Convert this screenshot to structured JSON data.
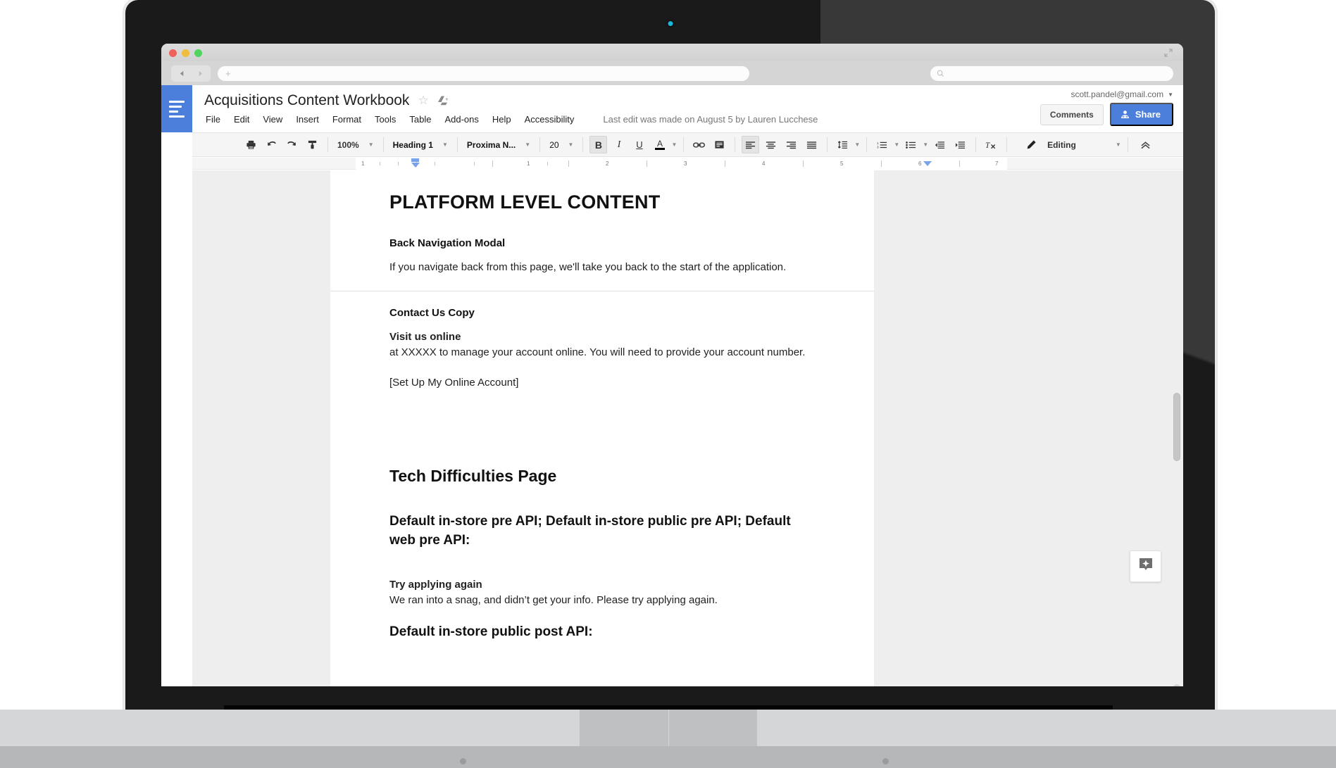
{
  "browser": {
    "traffic_lights": [
      "close",
      "minimize",
      "zoom"
    ],
    "back_label": "◀",
    "forward_label": "▶",
    "url_value": "",
    "url_placeholder": "+",
    "search_value": "",
    "search_placeholder": "",
    "expand_icon": "expand-icon"
  },
  "app": {
    "title": "Acquisitions Content Workbook",
    "star_icon": "☆",
    "drive_icon": "drive-icon",
    "menu": [
      {
        "label": "File"
      },
      {
        "label": "Edit"
      },
      {
        "label": "View"
      },
      {
        "label": "Insert"
      },
      {
        "label": "Format"
      },
      {
        "label": "Tools"
      },
      {
        "label": "Table"
      },
      {
        "label": "Add-ons"
      },
      {
        "label": "Help"
      },
      {
        "label": "Accessibility"
      }
    ],
    "last_edit": "Last edit was made on August 5 by Lauren Lucchese",
    "account_email": "scott.pandel@gmail.com",
    "comments_label": "Comments",
    "share_label": "Share",
    "accent_blue": "#4b7fdb"
  },
  "toolbar": {
    "print_icon": "print-icon",
    "undo_icon": "undo-icon",
    "redo_icon": "redo-icon",
    "paint_format_icon": "paint-format-icon",
    "zoom_value": "100%",
    "style_value": "Heading 1",
    "font_value": "Proxima N...",
    "size_value": "20",
    "bold_label": "B",
    "italic_label": "I",
    "underline_label": "U",
    "text_color_label": "A",
    "link_icon": "link-icon",
    "comment_icon": "add-comment-icon",
    "align_left_icon": "align-left-icon",
    "align_center_icon": "align-center-icon",
    "align_right_icon": "align-right-icon",
    "align_justify_icon": "align-justify-icon",
    "line_spacing_icon": "line-spacing-icon",
    "numbered_list_icon": "numbered-list-icon",
    "bulleted_list_icon": "bulleted-list-icon",
    "outdent_icon": "decrease-indent-icon",
    "indent_icon": "increase-indent-icon",
    "clear_format_icon": "clear-formatting-icon",
    "mode_label": "Editing",
    "pencil_icon": "pencil-icon",
    "collapse_icon": "collapse-toolbar-icon"
  },
  "ruler": {
    "numbers": [
      "1",
      "1",
      "2",
      "3",
      "4",
      "5",
      "6",
      "7"
    ]
  },
  "document": {
    "heading": "PLATFORM LEVEL CONTENT",
    "sections": [
      {
        "subheading": "Back Navigation Modal",
        "body": "If you navigate back from this page, we'll take you back to the start of the application."
      },
      {
        "subheading": "Contact Us Copy",
        "label": "Visit us online",
        "body": "at XXXXX to manage your account online. You will need to provide your account number.",
        "cta": "[Set Up My Online Account]"
      }
    ],
    "tech_heading": "Tech Difficulties Page",
    "api_block": "Default in-store pre API; Default in-store public pre API; Default web pre API:",
    "try_again_label": "Try applying again",
    "try_again_body": "We ran into a snag, and didn’t get your info. Please try applying again.",
    "post_api_label": "Default in-store public post API:"
  },
  "explore": {
    "icon": "explore-icon"
  }
}
